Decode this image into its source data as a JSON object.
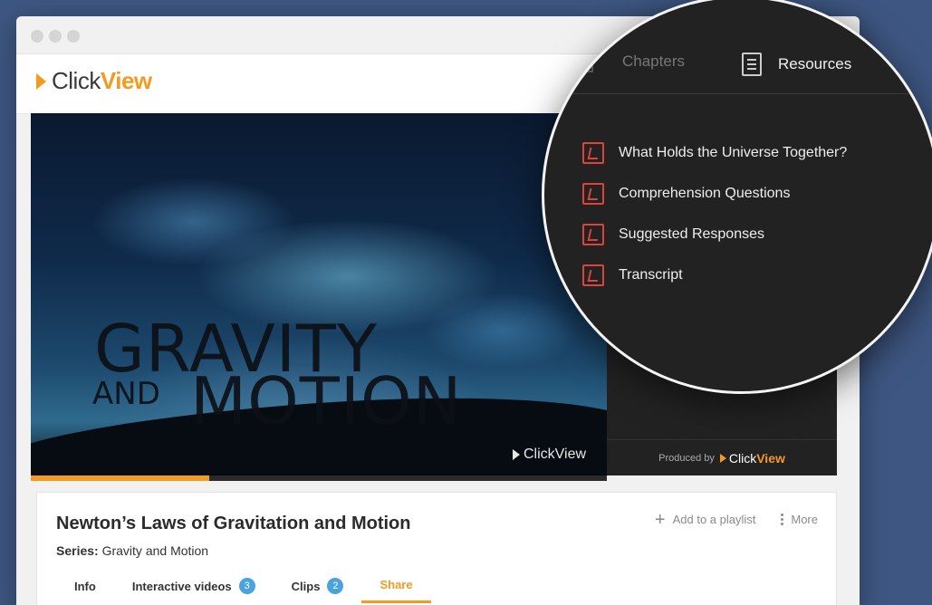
{
  "app": {
    "logo_text_click": "Click",
    "logo_text_view": "View"
  },
  "video": {
    "poster_title_line1": "GRAVITY",
    "poster_title_and": "AND",
    "poster_title_line2": "MOTION",
    "watermark_click": "Click",
    "watermark_view": "View",
    "progress_fraction": 0.31
  },
  "panel": {
    "tabs": [
      {
        "label": "Chapters",
        "active": false
      },
      {
        "label": "Resources",
        "active": true
      }
    ],
    "resources": [
      {
        "label": "What Holds the Universe Together?",
        "icon": "pdf-icon"
      },
      {
        "label": "Comprehension Questions",
        "icon": "pdf-icon"
      },
      {
        "label": "Suggested Responses",
        "icon": "pdf-icon"
      },
      {
        "label": "Transcript",
        "icon": "pdf-icon"
      }
    ],
    "produced_by": "Produced by",
    "produced_brand_click": "Click",
    "produced_brand_view": "View"
  },
  "info": {
    "title": "Newton’s Laws of Gravitation and Motion",
    "series_label": "Series:",
    "series_value": "Gravity and Motion",
    "add_playlist": "Add to a playlist",
    "more": "More",
    "tabs": [
      {
        "label": "Info",
        "badge": null,
        "active": false
      },
      {
        "label": "Interactive videos",
        "badge": "3",
        "active": false
      },
      {
        "label": "Clips",
        "badge": "2",
        "active": false
      },
      {
        "label": "Share",
        "badge": null,
        "active": true
      }
    ]
  },
  "colors": {
    "accent": "#f39a1f",
    "badge": "#4aa3df",
    "pdf": "#d9453a",
    "background": "#3e5782"
  }
}
